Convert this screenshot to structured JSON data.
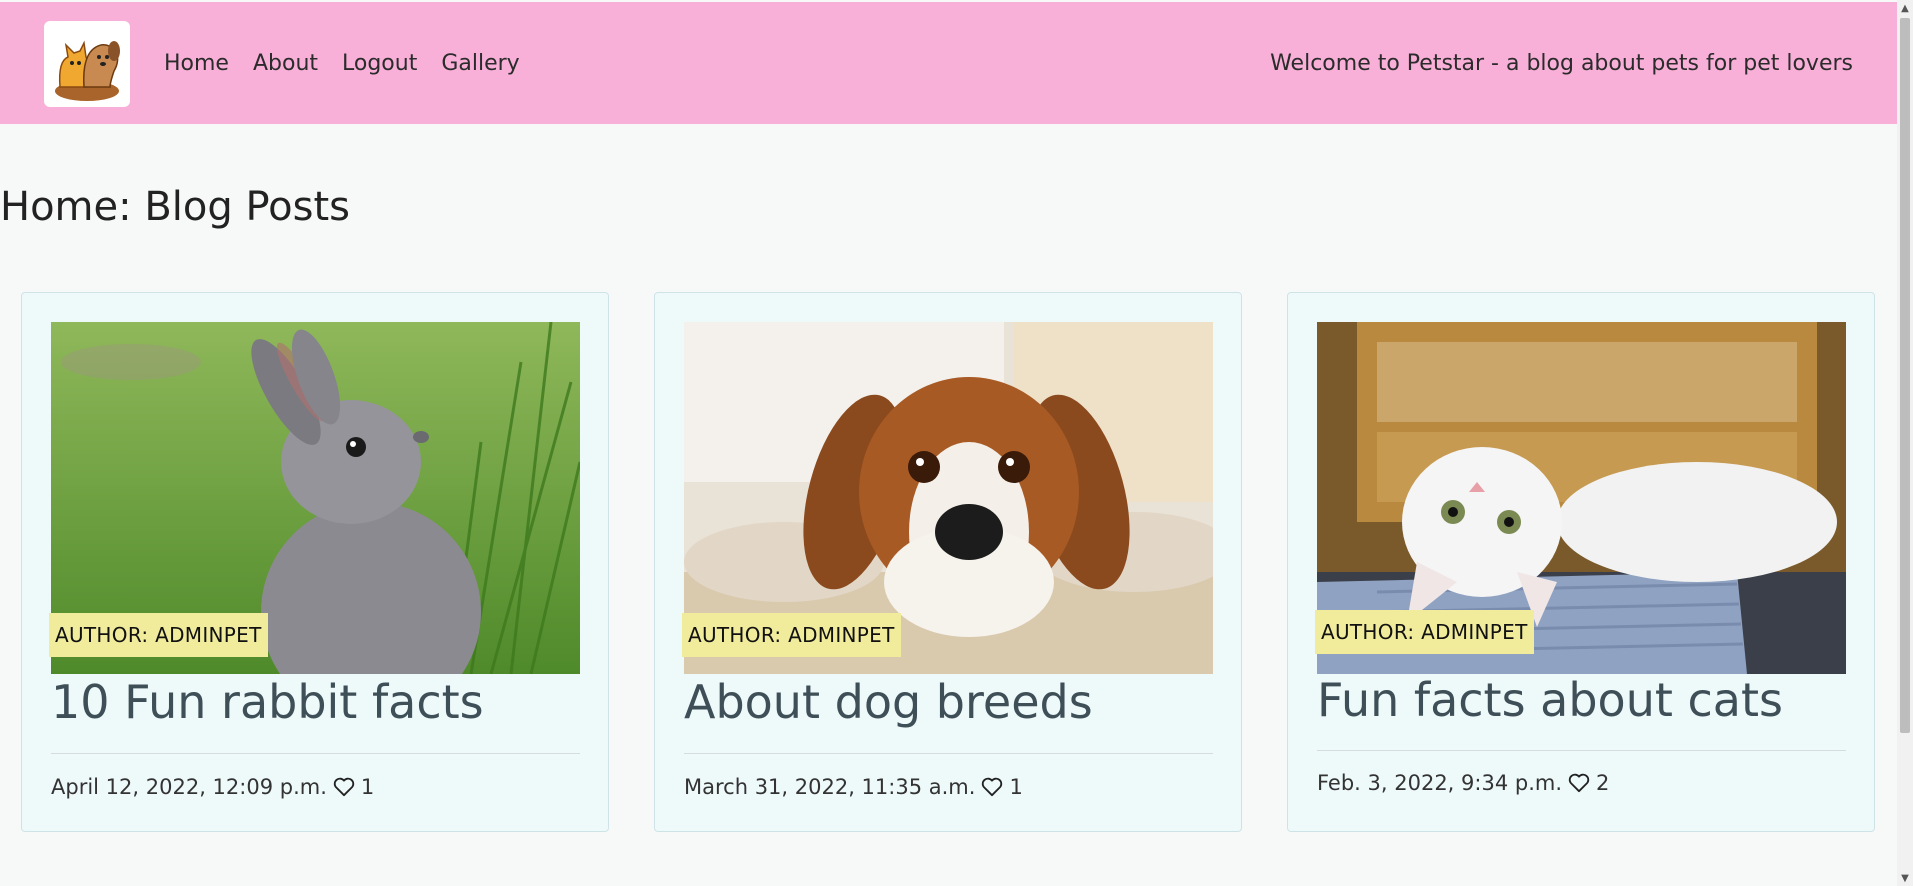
{
  "nav": {
    "links": [
      "Home",
      "About",
      "Logout",
      "Gallery"
    ],
    "tagline": "Welcome to Petstar - a blog about pets for pet lovers"
  },
  "page_title": "Home: Blog Posts",
  "posts": [
    {
      "author": "AUTHOR: ADMINPET",
      "title": "10 Fun rabbit facts",
      "date": "April 12, 2022, 12:09 p.m.",
      "likes": "1",
      "image": "rabbit-photo"
    },
    {
      "author": "AUTHOR: ADMINPET",
      "title": "About dog breeds",
      "date": "March 31, 2022, 11:35 a.m.",
      "likes": "1",
      "image": "dog-photo"
    },
    {
      "author": "AUTHOR: ADMINPET",
      "title": "Fun facts about cats",
      "date": "Feb. 3, 2022, 9:34 p.m.",
      "likes": "2",
      "image": "cat-photo"
    }
  ],
  "colors": {
    "navbar": "#f8b0d8",
    "card_bg": "#eef9fa",
    "badge": "#f1ec9b",
    "title": "#3f4f58"
  }
}
